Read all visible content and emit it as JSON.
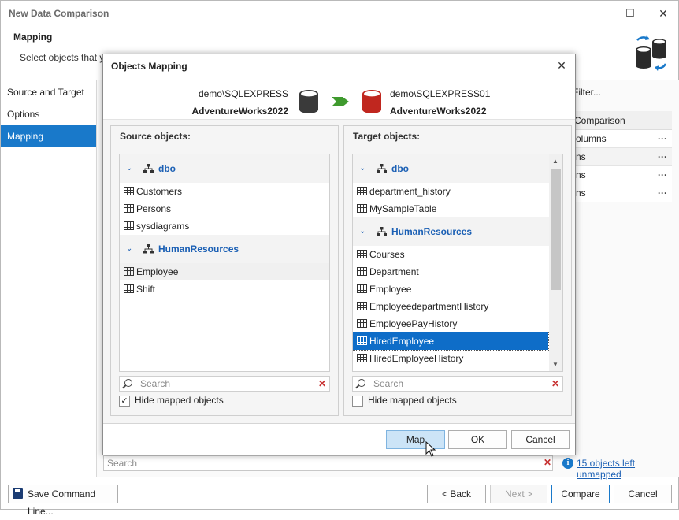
{
  "wizard": {
    "title": "New Data Comparison",
    "header_title": "Mapping",
    "header_desc": "Select objects that yo",
    "nav": [
      "Source and Target",
      "Options",
      "Mapping"
    ],
    "filter_label": "Filter...",
    "comparison_header": "Comparison",
    "comparison_rows": [
      "olumns",
      "ns",
      "ns",
      "ns"
    ],
    "search_placeholder": "Search",
    "unmapped_link": "15 objects left unmapped",
    "buttons": {
      "save_cmd": "Save Command Line...",
      "back": "< Back",
      "next": "Next >",
      "compare": "Compare",
      "cancel": "Cancel"
    }
  },
  "dialog": {
    "title": "Objects Mapping",
    "source": {
      "server": "demo\\SQLEXPRESS",
      "database": "AdventureWorks2022",
      "color": "#3a3a3a"
    },
    "target": {
      "server": "demo\\SQLEXPRESS01",
      "database": "AdventureWorks2022",
      "color": "#c0271f"
    },
    "arrow_color": "#3f9a2e",
    "source_panel": {
      "title": "Source objects:",
      "groups": [
        {
          "name": "dbo",
          "items": [
            "Customers",
            "Persons",
            "sysdiagrams"
          ]
        },
        {
          "name": "HumanResources",
          "items": [
            "Employee",
            "Shift"
          ]
        }
      ],
      "search_placeholder": "Search",
      "hide_mapped_label": "Hide mapped objects",
      "hide_mapped_checked": "✓"
    },
    "target_panel": {
      "title": "Target objects:",
      "groups": [
        {
          "name": "dbo",
          "items": [
            "department_history",
            "MySampleTable"
          ]
        },
        {
          "name": "HumanResources",
          "items": [
            "Courses",
            "Department",
            "Employee",
            "EmployeedepartmentHistory",
            "EmployeePayHistory",
            "HiredEmployee",
            "HiredEmployeeHistory"
          ]
        }
      ],
      "search_placeholder": "Search",
      "hide_mapped_label": "Hide mapped objects",
      "hide_mapped_checked": ""
    },
    "buttons": {
      "map": "Map",
      "ok": "OK",
      "cancel": "Cancel"
    }
  }
}
